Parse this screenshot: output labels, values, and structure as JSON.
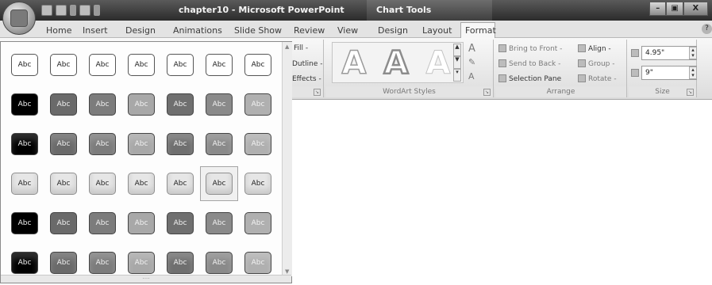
{
  "window": {
    "title": "chapter10 - Microsoft PowerPoint",
    "context_tab_group": "Chart Tools",
    "controls": [
      "–",
      "▣",
      "X"
    ]
  },
  "tabs": [
    "Home",
    "Insert",
    "Design",
    "Animations",
    "Slide Show",
    "Review",
    "View",
    "Design",
    "Layout",
    "Format"
  ],
  "active_tab": "Format",
  "ribbon": {
    "shape_styles_partial": {
      "fill": "Fill -",
      "outline": "Dutline -",
      "effects": "Effects -"
    },
    "wordart": {
      "letter": "A",
      "group_label": "WordArt Styles"
    },
    "arrange": {
      "bring_to_front": "Bring to Front -",
      "send_to_back": "Send to Back -",
      "selection_pane": "Selection Pane",
      "align": "Align -",
      "group": "Group -",
      "rotate": "Rotate -",
      "group_label": "Arrange"
    },
    "size": {
      "height": "4.95\"",
      "width": "9\"",
      "group_label": "Size"
    }
  },
  "gallery": {
    "label": "Abc",
    "rows": [
      [
        "#ffffff",
        "#ffffff",
        "#ffffff",
        "#ffffff",
        "#ffffff",
        "#ffffff",
        "#ffffff"
      ],
      [
        "#000000",
        "#6a6a6a",
        "#7c7c7c",
        "#a8a8a8",
        "#6f6f6f",
        "#8a8a8a",
        "#b0b0b0"
      ],
      [
        "#000000",
        "#6a6a6a",
        "#7c7c7c",
        "#a8a8a8",
        "#6f6f6f",
        "#8a8a8a",
        "#b0b0b0"
      ],
      [
        "#e6e6e6",
        "#e6e6e6",
        "#e6e6e6",
        "#e6e6e6",
        "#e6e6e6",
        "#e6e6e6",
        "#e6e6e6"
      ],
      [
        "#000000",
        "#6a6a6a",
        "#7c7c7c",
        "#a8a8a8",
        "#6f6f6f",
        "#8a8a8a",
        "#b0b0b0"
      ],
      [
        "#000000",
        "#6a6a6a",
        "#7c7c7c",
        "#a8a8a8",
        "#6f6f6f",
        "#8a8a8a",
        "#b0b0b0"
      ]
    ],
    "selected": {
      "row": 3,
      "col": 5
    },
    "grip": "····"
  }
}
